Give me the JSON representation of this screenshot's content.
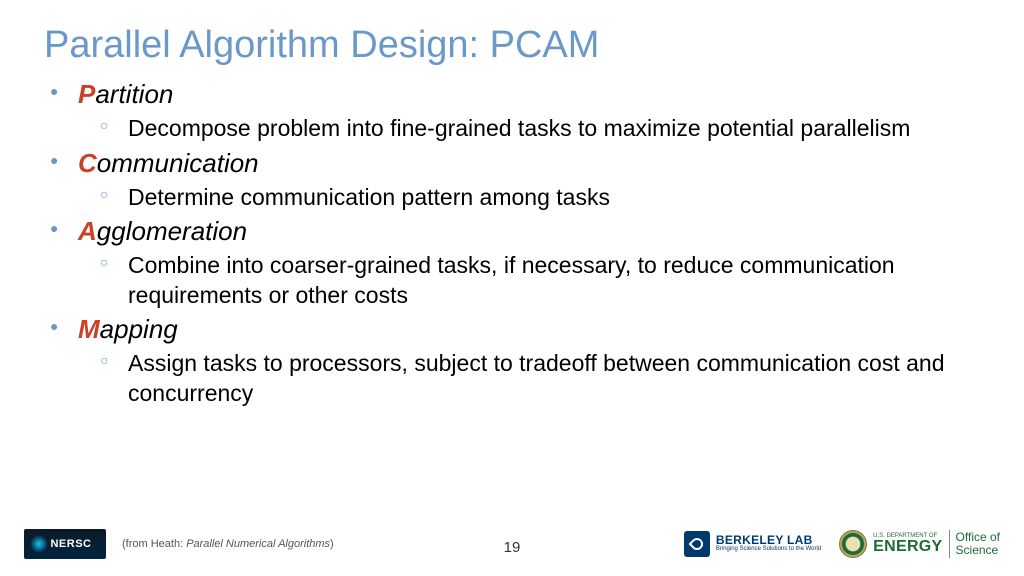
{
  "title": "Parallel Algorithm Design: PCAM",
  "items": [
    {
      "accent": "P",
      "rest": "artition",
      "subs": [
        "Decompose problem into fine-grained tasks to maximize potential parallelism"
      ]
    },
    {
      "accent": "C",
      "rest": "ommunication",
      "subs": [
        "Determine communication pattern among tasks"
      ]
    },
    {
      "accent": "A",
      "rest": "gglomeration",
      "subs": [
        "Combine into coarser-grained tasks, if necessary, to reduce communication requirements or other costs"
      ]
    },
    {
      "accent": "M",
      "rest": "apping",
      "subs": [
        "Assign tasks to processors, subject to tradeoff between communication cost and concurrency"
      ]
    }
  ],
  "footer": {
    "nersc": "NERSC",
    "attribution_prefix": "(from Heath: ",
    "attribution_title": "Parallel Numerical Algorithms",
    "attribution_suffix": ")",
    "page": "19",
    "berkeley": "BERKELEY LAB",
    "berkeley_tag": "Bringing Science Solutions to the World",
    "doe_dept": "U.S. DEPARTMENT OF",
    "doe": "ENERGY",
    "office1": "Office of",
    "office2": "Science"
  }
}
